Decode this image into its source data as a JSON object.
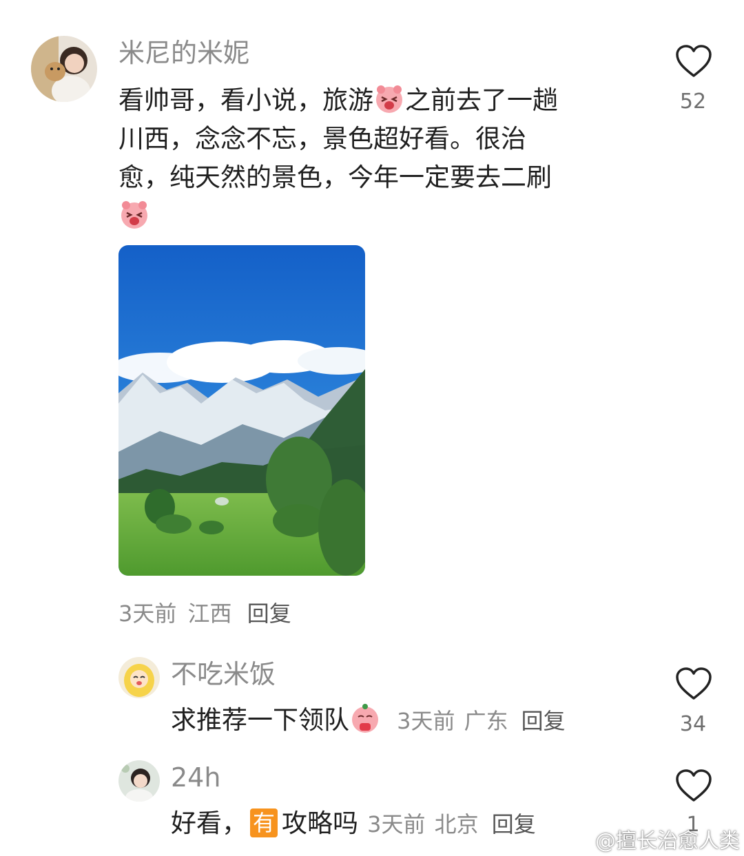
{
  "comments": [
    {
      "username": "米尼的米妮",
      "text_line1_a": "看帅哥，看小说，旅游",
      "text_line1_b": "之前去了一趟",
      "text_line2": "川西，念念不忘，景色超好看。很治",
      "text_line3": "愈，纯天然的景色，今年一定要去二刷",
      "meta_time": "3天前",
      "meta_location": "江西",
      "reply_label": "回复",
      "likes": "52",
      "emoji_1": "laughing-pig-emoji",
      "emoji_2": "laughing-pig-emoji",
      "image": "mountain-landscape-photo"
    }
  ],
  "replies": [
    {
      "username": "不吃米饭",
      "text": "求推荐一下领队",
      "emoji": "praying-pig-emoji",
      "meta_time": "3天前",
      "meta_location": "广东",
      "reply_label": "回复",
      "likes": "34"
    },
    {
      "username": "24h",
      "text_a": "好看，",
      "tag": "有",
      "text_b": "攻略吗",
      "meta_time": "3天前",
      "meta_location": "北京",
      "reply_label": "回复",
      "likes": "1"
    }
  ],
  "watermark": "@擅长治愈人类",
  "colors": {
    "username": "#8a8a8a",
    "text": "#1f1f1f",
    "tag_bg": "#f7931e",
    "sky": "#1f7fd6"
  }
}
